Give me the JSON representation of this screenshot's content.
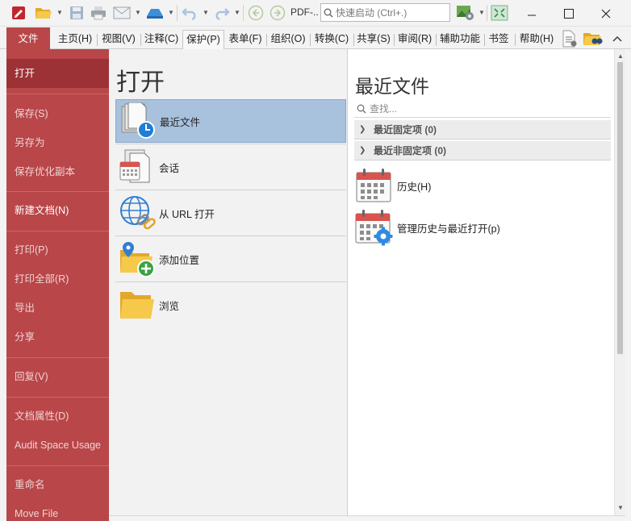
{
  "toolbar": {
    "pdf_label": "PDF-..",
    "search_placeholder": "快速启动 (Ctrl+.)"
  },
  "window": {
    "minimize": "—",
    "maximize": "☐",
    "close": "✕"
  },
  "tabs": [
    {
      "label": "文件"
    },
    {
      "label": "主页(H)"
    },
    {
      "label": "视图(V)"
    },
    {
      "label": "注释(C)"
    },
    {
      "label": "保护(P)"
    },
    {
      "label": "表单(F)"
    },
    {
      "label": "组织(O)"
    },
    {
      "label": "转换(C)"
    },
    {
      "label": "共享(S)"
    },
    {
      "label": "审阅(R)"
    },
    {
      "label": "辅助功能"
    },
    {
      "label": "书签"
    },
    {
      "label": "帮助(H)"
    }
  ],
  "sidebar": {
    "items": [
      {
        "label": "打开"
      },
      {
        "label": "保存(S)"
      },
      {
        "label": "另存为"
      },
      {
        "label": "保存优化副本"
      },
      {
        "label": "新建文档(N)"
      },
      {
        "label": "打印(P)"
      },
      {
        "label": "打印全部(R)"
      },
      {
        "label": "导出"
      },
      {
        "label": "分享"
      },
      {
        "label": "回复(V)"
      },
      {
        "label": "文档属性(D)"
      },
      {
        "label": "Audit Space Usage"
      },
      {
        "label": "重命名"
      },
      {
        "label": "Move File"
      }
    ]
  },
  "open_panel": {
    "title": "打开",
    "items": [
      {
        "label": "最近文件",
        "icon": "recent-files-icon"
      },
      {
        "label": "会话",
        "icon": "sessions-icon"
      },
      {
        "label": "从 URL 打开",
        "icon": "globe-link-icon"
      },
      {
        "label": "添加位置",
        "icon": "add-location-icon"
      },
      {
        "label": "浏览",
        "icon": "folder-icon"
      }
    ]
  },
  "recent_panel": {
    "title": "最近文件",
    "search_placeholder": "查找...",
    "groups": [
      {
        "label": "最近固定项 (0)"
      },
      {
        "label": "最近非固定项 (0)"
      }
    ],
    "items": [
      {
        "label": "历史(H)",
        "icon": "calendar-icon"
      },
      {
        "label": "管理历史与最近打开(p)",
        "icon": "calendar-gear-icon"
      }
    ]
  },
  "colors": {
    "accent": "#b94649",
    "accent_dark": "#9c3235",
    "selection": "#a8c1dd"
  }
}
